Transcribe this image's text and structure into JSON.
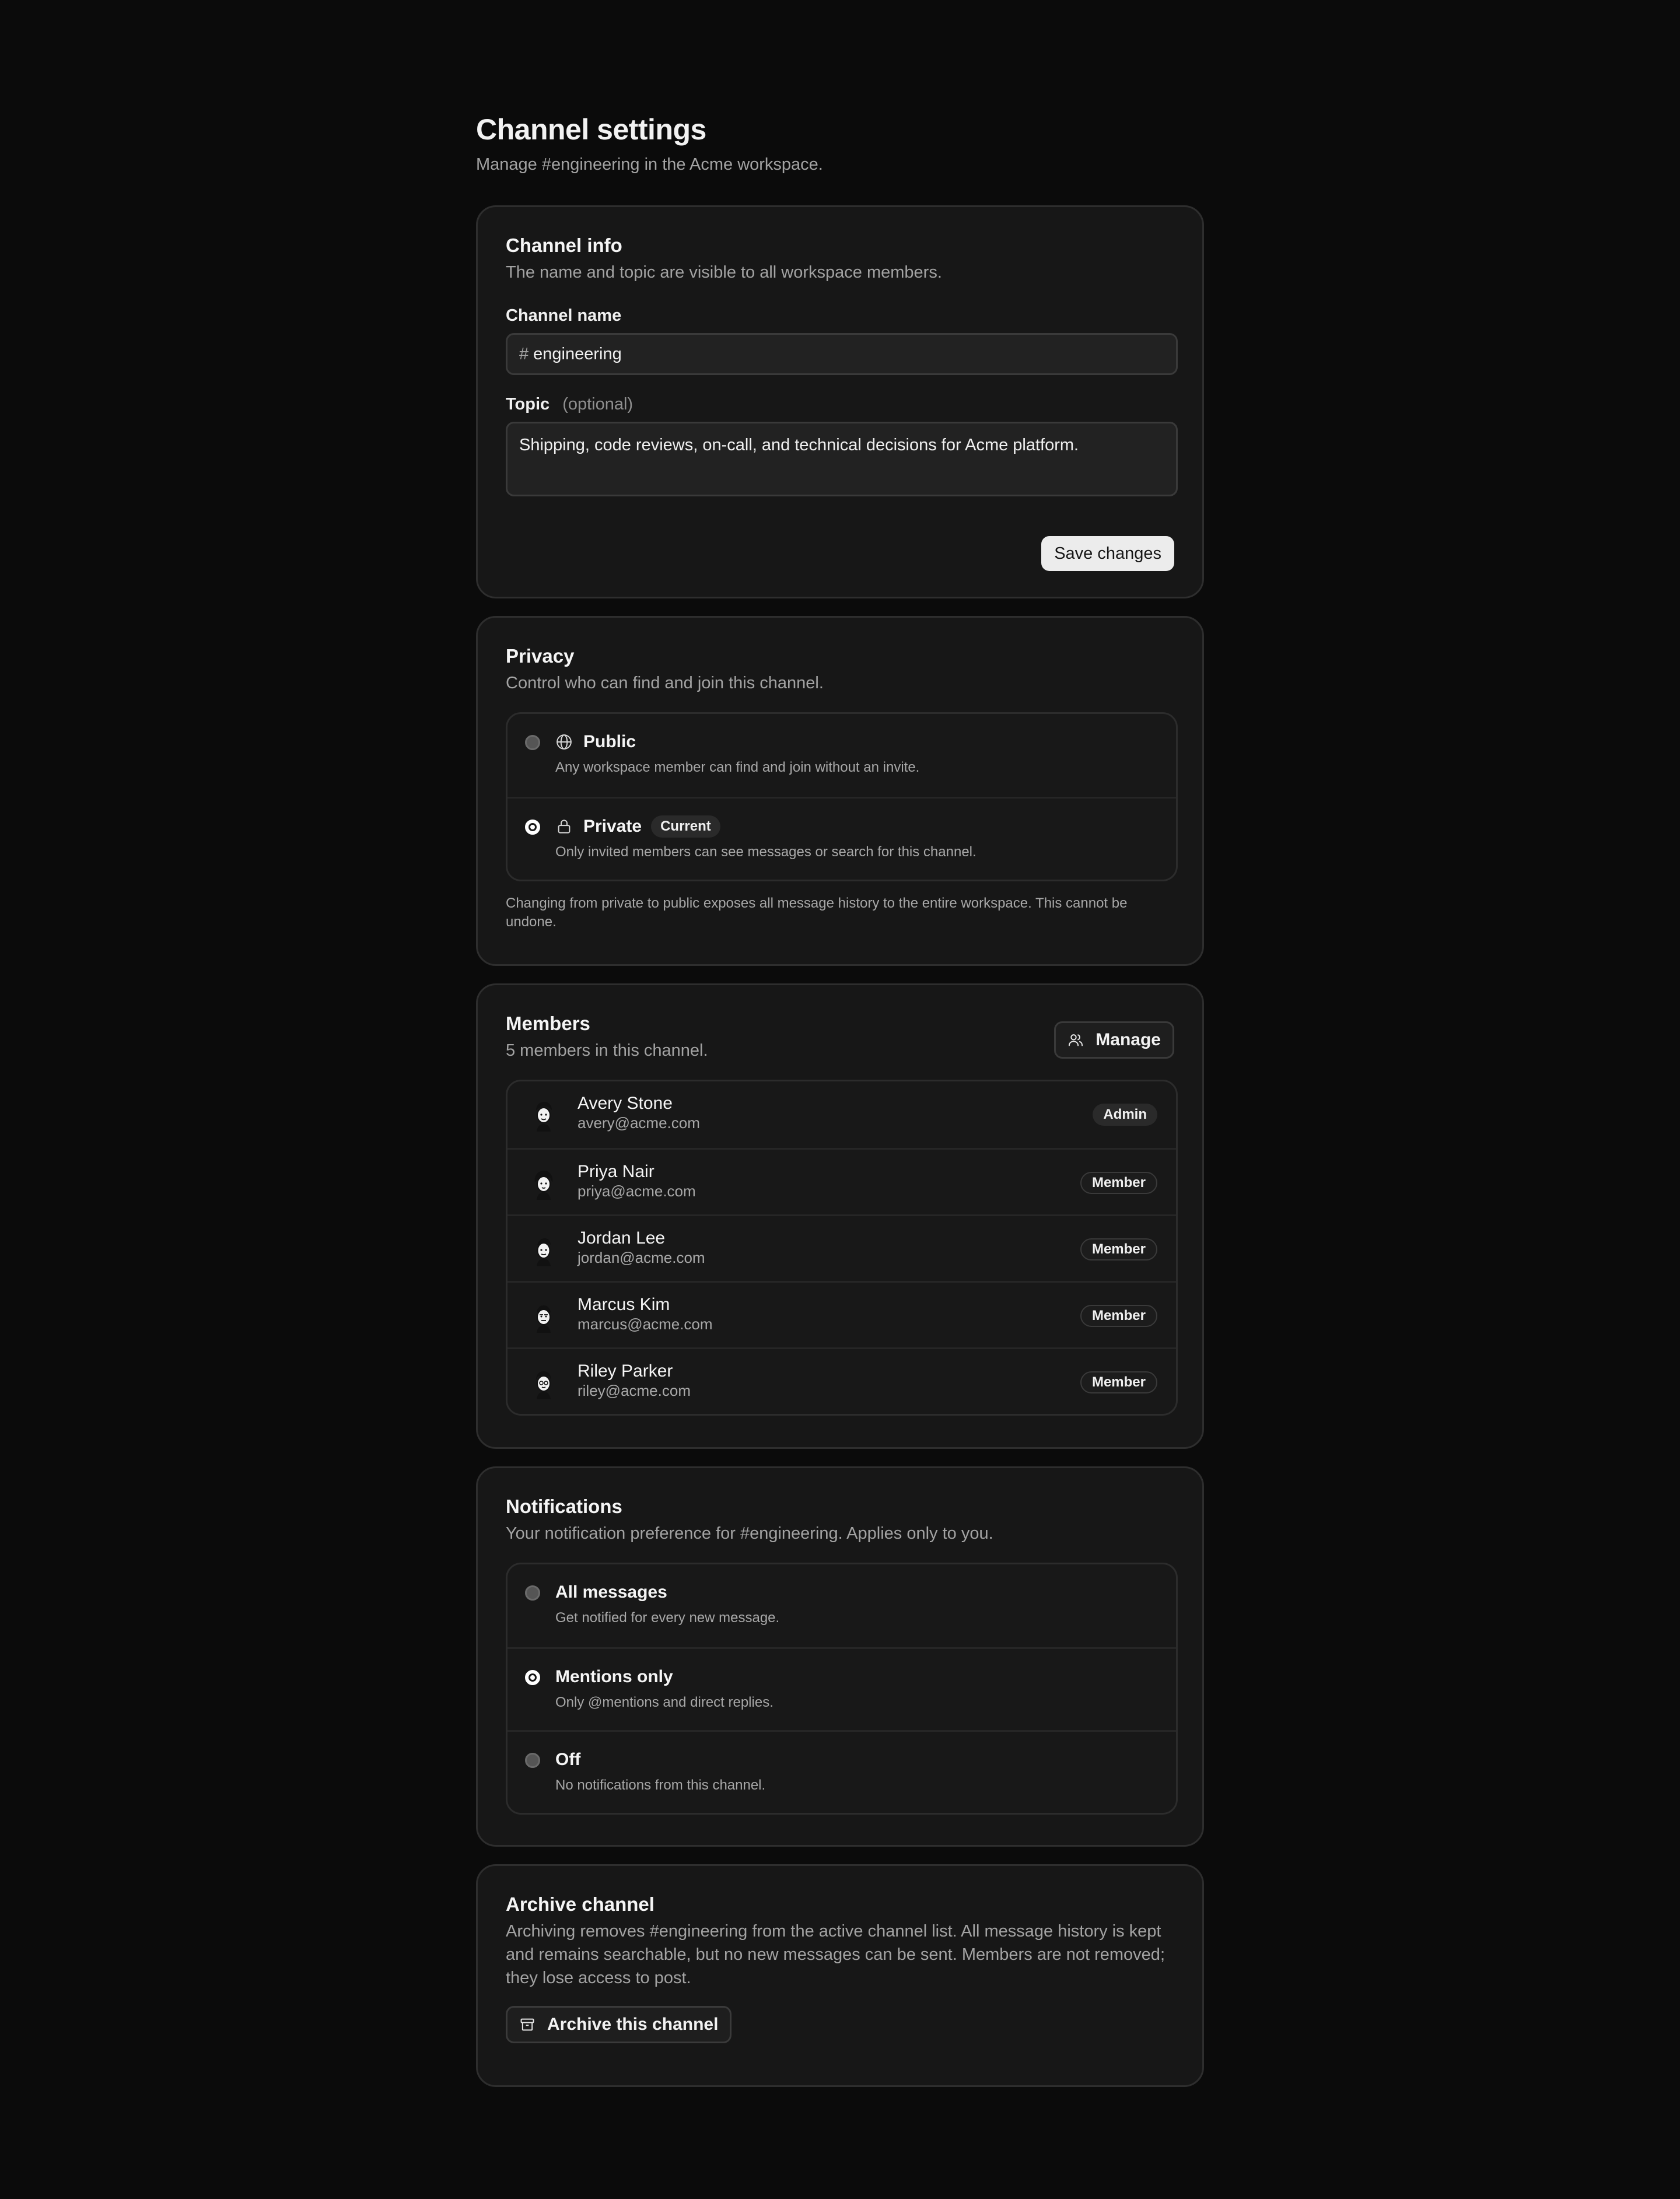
{
  "header": {
    "title": "Channel settings",
    "subtitle": "Manage #engineering in the Acme workspace."
  },
  "channel_info": {
    "title": "Channel info",
    "description": "The name and topic are visible to all workspace members.",
    "name_label": "Channel name",
    "name_prefix": "#",
    "name_value": "engineering",
    "topic_label": "Topic",
    "topic_optional": "(optional)",
    "topic_value": "Shipping, code reviews, on-call, and technical decisions for Acme platform.",
    "save_label": "Save changes"
  },
  "privacy": {
    "title": "Privacy",
    "description": "Control who can find and join this channel.",
    "options": [
      {
        "name": "Public",
        "description": "Any workspace member can find and join without an invite.",
        "icon": "globe-icon",
        "selected": false
      },
      {
        "name": "Private",
        "description": "Only invited members can see messages or search for this channel.",
        "icon": "lock-icon",
        "selected": true,
        "badge": "Current"
      }
    ],
    "note": "Changing from private to public exposes all message history to the entire workspace. This cannot be undone."
  },
  "members": {
    "title": "Members",
    "description": "5 members in this channel.",
    "manage_label": "Manage",
    "list": [
      {
        "name": "Avery Stone",
        "email": "avery@acme.com",
        "role": "Admin"
      },
      {
        "name": "Priya Nair",
        "email": "priya@acme.com",
        "role": "Member"
      },
      {
        "name": "Jordan Lee",
        "email": "jordan@acme.com",
        "role": "Member"
      },
      {
        "name": "Marcus Kim",
        "email": "marcus@acme.com",
        "role": "Member"
      },
      {
        "name": "Riley Parker",
        "email": "riley@acme.com",
        "role": "Member"
      }
    ]
  },
  "notifications": {
    "title": "Notifications",
    "description": "Your notification preference for #engineering. Applies only to you.",
    "options": [
      {
        "name": "All messages",
        "description": "Get notified for every new message.",
        "selected": false
      },
      {
        "name": "Mentions only",
        "description": "Only @mentions and direct replies.",
        "selected": true
      },
      {
        "name": "Off",
        "description": "No notifications from this channel.",
        "selected": false
      }
    ]
  },
  "archive": {
    "title": "Archive channel",
    "description": "Archiving removes #engineering from the active channel list. All message history is kept and remains searchable, but no new messages can be sent. Members are not removed; they lose access to post.",
    "button_label": "Archive this channel"
  },
  "colors": {
    "background": "#0b0b0b",
    "card": "#171717",
    "border": "#2e2e2e",
    "text": "#f2f2f2",
    "muted": "#a3a3a3"
  }
}
